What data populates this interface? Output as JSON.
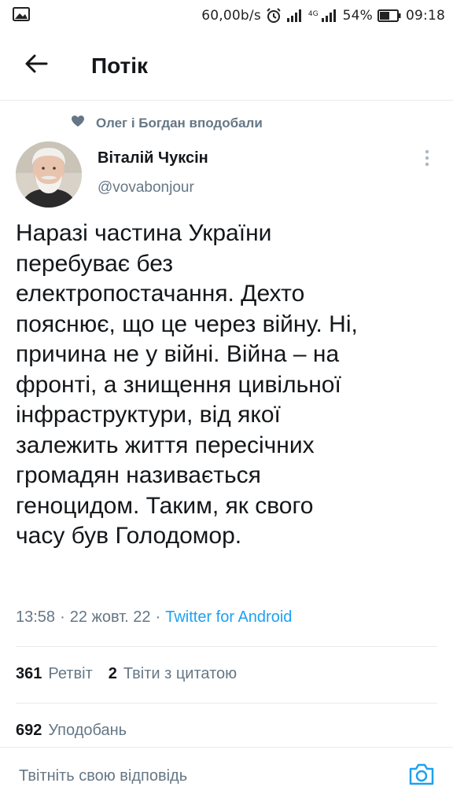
{
  "status_bar": {
    "network_speed": "60,00b/s",
    "network_type": "4G",
    "battery_percent": "54%",
    "time": "09:18",
    "icons": [
      "image-icon",
      "alarm-icon",
      "signal-icon",
      "battery-icon"
    ]
  },
  "header": {
    "back_icon": "arrow-left-icon",
    "title": "Потік"
  },
  "social_context": {
    "icon": "heart-icon",
    "text": "Олег і Богдан вподобали"
  },
  "tweet": {
    "author_name": "Віталій Чуксін",
    "author_handle": "@vovabonjour",
    "text": "Наразі частина України\nперебуває без\nелектропостачання. Дехто\nпояснює, що це через війну. Ні,\nпричина не у війні. Війна – на\nфронті, а знищення цивільної\nінфраструктури, від якої\nзалежить життя пересічних\nгромадян називається\nгеноцидом. Таким, як свого\nчасу був Голодомор.",
    "time": "13:58",
    "date": "22 жовт. 22",
    "separator": "·",
    "source": "Twitter for Android",
    "retweets_count": "361",
    "retweets_label": "Ретвіт",
    "quotes_count": "2",
    "quotes_label": "Твіти з цитатою",
    "likes_count": "692",
    "likes_label": "Уподобань"
  },
  "reply": {
    "placeholder": "Твітніть свою відповідь",
    "camera_icon": "camera-icon"
  },
  "colors": {
    "accent": "#1da1f2",
    "secondary_text": "#657786",
    "divider": "#e6ecf0"
  }
}
